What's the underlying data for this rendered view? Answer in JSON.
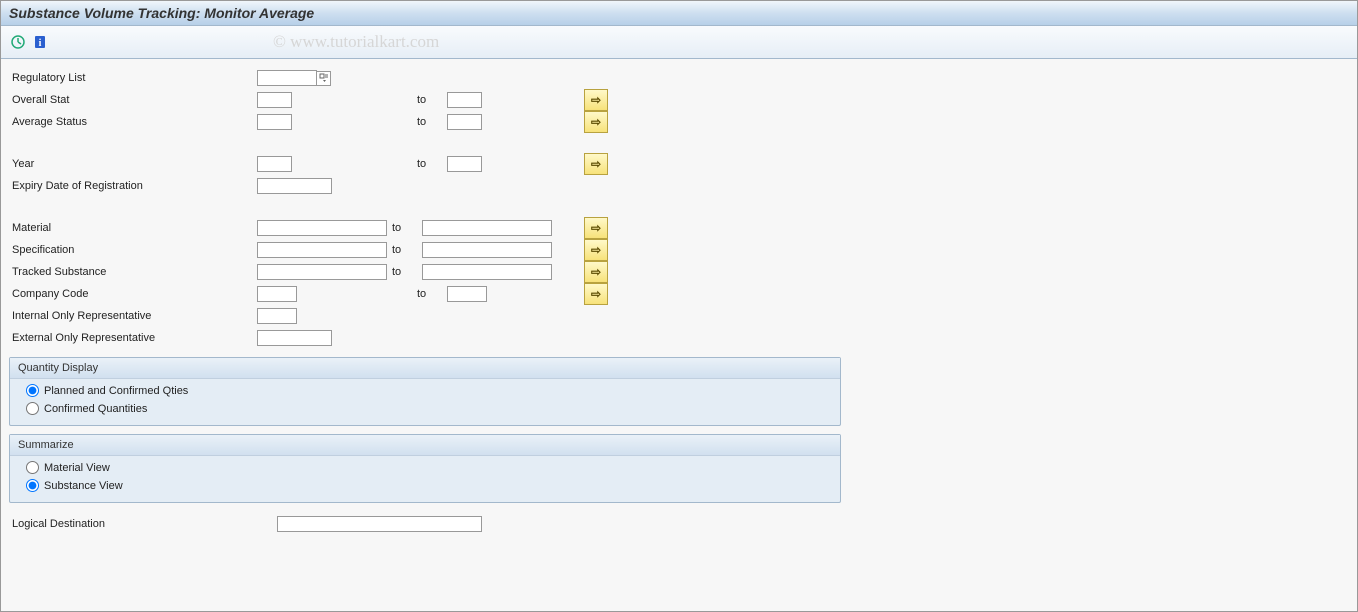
{
  "title": "Substance Volume Tracking: Monitor Average",
  "watermark": "© www.tutorialkart.com",
  "labels": {
    "regulatory_list": "Regulatory List",
    "overall_stat": "Overall Stat",
    "average_status": "Average Status",
    "year": "Year",
    "expiry_date": "Expiry Date of Registration",
    "material": "Material",
    "specification": "Specification",
    "tracked_substance": "Tracked Substance",
    "company_code": "Company Code",
    "internal_rep": "Internal Only Representative",
    "external_rep": "External Only Representative",
    "to": "to",
    "logical_destination": "Logical Destination"
  },
  "quantity_display": {
    "title": "Quantity Display",
    "opt_planned": "Planned and Confirmed Qties",
    "opt_confirmed": "Confirmed Quantities",
    "selected": "planned"
  },
  "summarize": {
    "title": "Summarize",
    "opt_material": "Material View",
    "opt_substance": "Substance View",
    "selected": "substance"
  }
}
